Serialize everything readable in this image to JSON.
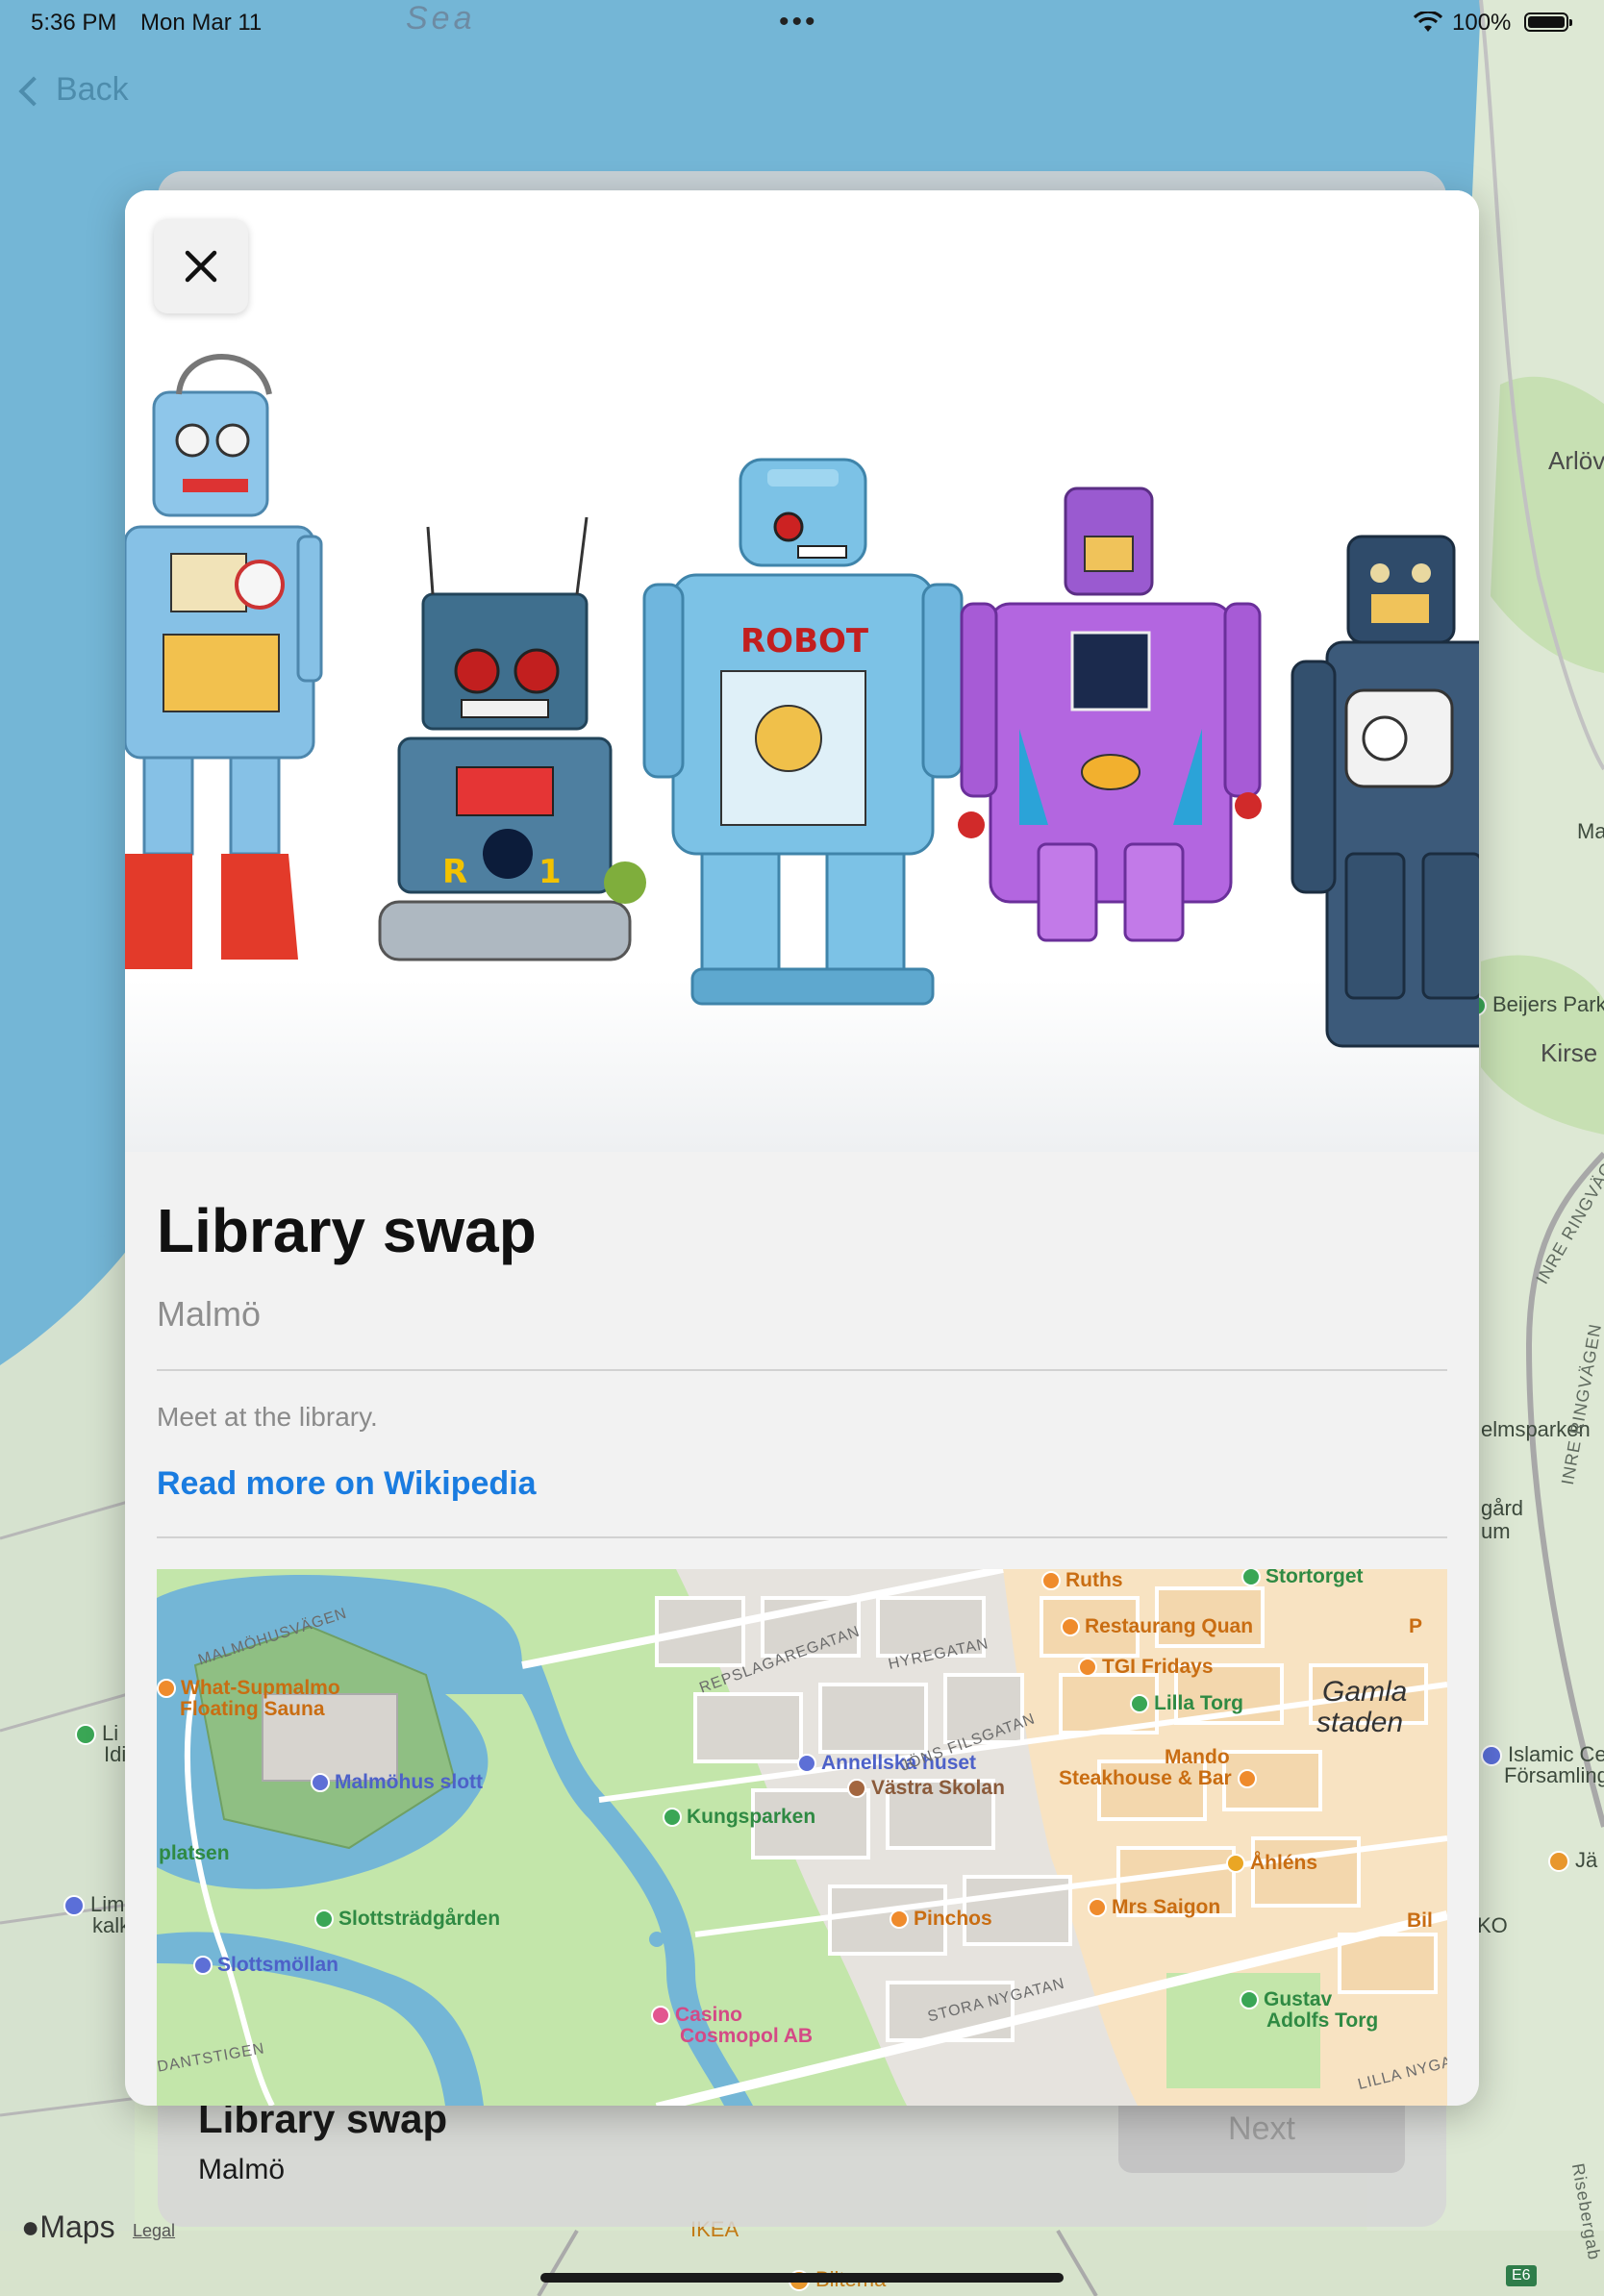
{
  "status_bar": {
    "time": "5:36 PM",
    "date": "Mon Mar 11",
    "battery": "100%",
    "multitask_dots": "•••"
  },
  "nav": {
    "back_label": "Back"
  },
  "background_map": {
    "labels": {
      "sea": "Sea",
      "arlov": "Arlöv",
      "beijers_park": "Beijers Park",
      "kirse": "Kirse",
      "ma": "Ma",
      "inre_ringvagen": "INRE RINGVÄGEN",
      "elmsparken": "elmsparken",
      "gard": "gård",
      "um": "um",
      "inreringvagen2": "INRE RINGVÄGEN",
      "islamic": "Islamic Cer",
      "forsamling": "Församling",
      "ja": "Jä",
      "ko": "KO",
      "li_1": "Li",
      "li_2": "Idi",
      "lim": "Lim",
      "kalk": "kalk",
      "ikea": "IKEA",
      "biltema": "Biltema",
      "risebergabacken": "Risebergab",
      "e6": "E6"
    },
    "maps_brand": "Maps",
    "legal": "Legal"
  },
  "under_sheet": {
    "title": "Library swap",
    "subtitle": "Malmö",
    "next_label": "Next"
  },
  "modal": {
    "title": "Library swap",
    "subtitle": "Malmö",
    "description": "Meet at the library.",
    "link": "Read more on Wikipedia",
    "hero_robot_labels": {
      "robot": "ROBOT",
      "r": "R",
      "one": "1"
    }
  },
  "mini_map": {
    "labels": {
      "malmohusvagen": "MALMÖHUSVÄGEN",
      "what_supmalmo": "What-Supmalmo",
      "floating_sauna": "Floating Sauna",
      "malmohus_slott": "Malmöhus slott",
      "platsen": "platsen",
      "slottstradgarden": "Slottsträdgården",
      "slottsmollan": "Slottsmöllan",
      "dantstigen": "DANTSTIGEN",
      "kungsparken": "Kungsparken",
      "casino_1": "Casino",
      "casino_2": "Cosmopol AB",
      "repslagaregatan": "REPSLAGAREGATAN",
      "hyregatan": "HYREGATAN",
      "annelska_huset": "Annellska huset",
      "jons_filsgatan": "JÖNS FILSGATAN",
      "vastra_skolan": "Västra Skolan",
      "pinchos": "Pinchos",
      "stora_nygatan": "STORA NYGATAN",
      "ruths": "Ruths",
      "restaurang_quan": "Restaurang Quan",
      "tgi_fridays": "TGI Fridays",
      "lilla_torg": "Lilla Torg",
      "mando_1": "Mando",
      "mando_2": "Steakhouse & Bar",
      "ahlens": "Åhléns",
      "mrs_saigon": "Mrs Saigon",
      "stortorget": "Stortorget",
      "gamla_1": "Gamla",
      "gamla_2": "staden",
      "bil": "Bil",
      "gustav_1": "Gustav",
      "gustav_2": "Adolfs Torg",
      "lilla_nyga": "LILLA NYGA",
      "p": "P"
    }
  },
  "colors": {
    "accent_link": "#1a7ce0",
    "water": "#6fb5d8",
    "park": "#bfe3a8",
    "old_town": "#f7dfb8"
  }
}
